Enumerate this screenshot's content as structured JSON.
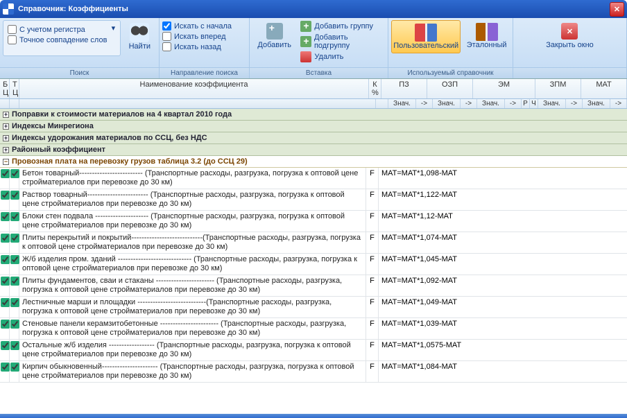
{
  "window": {
    "title": "Справочник: Коэффициенты"
  },
  "ribbon": {
    "search": {
      "case_sensitive": "С учетом регистра",
      "exact_match": "Точное совпадение слов",
      "find": "Найти",
      "from_start": "Искать с начала",
      "forward": "Искать вперед",
      "backward": "Искать назад",
      "group1": "Поиск",
      "group2": "Направление поиска"
    },
    "insert": {
      "add": "Добавить",
      "add_group": "Добавить группу",
      "add_subgroup": "Добавить подгруппу",
      "delete": "Удалить",
      "group": "Вставка"
    },
    "ref": {
      "user": "Пользовательский",
      "std": "Эталонный",
      "group": "Используемый справочник"
    },
    "close": {
      "label": "Закрыть окно"
    }
  },
  "headers": {
    "bc": "Б Ц",
    "tc": "Т Ц",
    "name": "Наименование коэффициента",
    "k": "К %",
    "pz": "ПЗ",
    "ozp": "ОЗП",
    "em": "ЭМ",
    "zpm": "ЗПМ",
    "mat": "МАТ",
    "val": "Знач.",
    "arrow": "->",
    "r": "Р",
    "ch": "Ч"
  },
  "groups": [
    {
      "label": "Поправки к стоимости материалов на 4 квартал 2010 года",
      "open": false
    },
    {
      "label": "Индексы Минрегиона",
      "open": false
    },
    {
      "label": "Индексы удорожания материалов по ССЦ, без НДС",
      "open": false
    },
    {
      "label": "Районный коэффициент",
      "open": false
    },
    {
      "label": "Провозная плата на перевозку грузов таблица 3.2 (до ССЦ 29)",
      "open": true
    }
  ],
  "rows": [
    {
      "name": "Бетон товарный------------------------- (Транспортные расходы, разгрузка, погрузка к оптовой цене  стройматериалов при перевозке до 30 км)",
      "k": "F",
      "f": "МАТ=МАТ*1,098-МАТ"
    },
    {
      "name": "Раствор товарный------------------------  (Транспортные расходы, разгрузка, погрузка к оптовой цене  стройматериалов при перевозке до 30 км)",
      "k": "F",
      "f": "МАТ=МАТ*1,122-МАТ"
    },
    {
      "name": "Блоки стен подвала --------------------- (Транспортные расходы, разгрузка, погрузка к оптовой цене  стройматериалов при перевозке до 30 км)",
      "k": "F",
      "f": "МАТ=МАТ*1,12-МАТ"
    },
    {
      "name": "Плиты перекрытий и покрытий----------------------------(Транспортные расходы, разгрузка, погрузка к оптовой цене  стройматериалов при перевозке до 30 км)",
      "k": "F",
      "f": "МАТ=МАТ*1,074-МАТ"
    },
    {
      "name": "Ж/б изделия пром. зданий ----------------------------- (Транспортные расходы, разгрузка, погрузка к оптовой цене  стройматериалов при перевозке до 30 км)",
      "k": "F",
      "f": "МАТ=МАТ*1,045-МАТ"
    },
    {
      "name": "Плиты фундаментов, сваи и стаканы ----------------------- (Транспортные расходы, разгрузка, погрузка к оптовой цене  стройматериалов при перевозке до 30 км)",
      "k": "F",
      "f": "МАТ=МАТ*1,092-МАТ"
    },
    {
      "name": "Лестничные марши и площадки ---------------------------(Транспортные расходы, разгрузка, погрузка к оптовой цене  стройматериалов при перевозке до 30 км)",
      "k": "F",
      "f": "МАТ=МАТ*1,049-МАТ"
    },
    {
      "name": "Стеновые панели керамзитобетонные ----------------------- (Транспортные расходы, разгрузка, погрузка к оптовой цене  стройматериалов при перевозке до 30 км)",
      "k": "F",
      "f": "МАТ=МАТ*1,039-МАТ"
    },
    {
      "name": "Остальные ж/б изделия ------------------ (Транспортные расходы, разгрузка, погрузка к оптовой цене  стройматериалов при перевозке до 30 км)",
      "k": "F",
      "f": "МАТ=МАТ*1,0575-МАТ"
    },
    {
      "name": "Кирпич обыкновенный---------------------- (Транспортные расходы, разгрузка, погрузка к оптовой цене  стройматериалов при перевозке до 30 км)",
      "k": "F",
      "f": "МАТ=МАТ*1,084-МАТ"
    }
  ]
}
